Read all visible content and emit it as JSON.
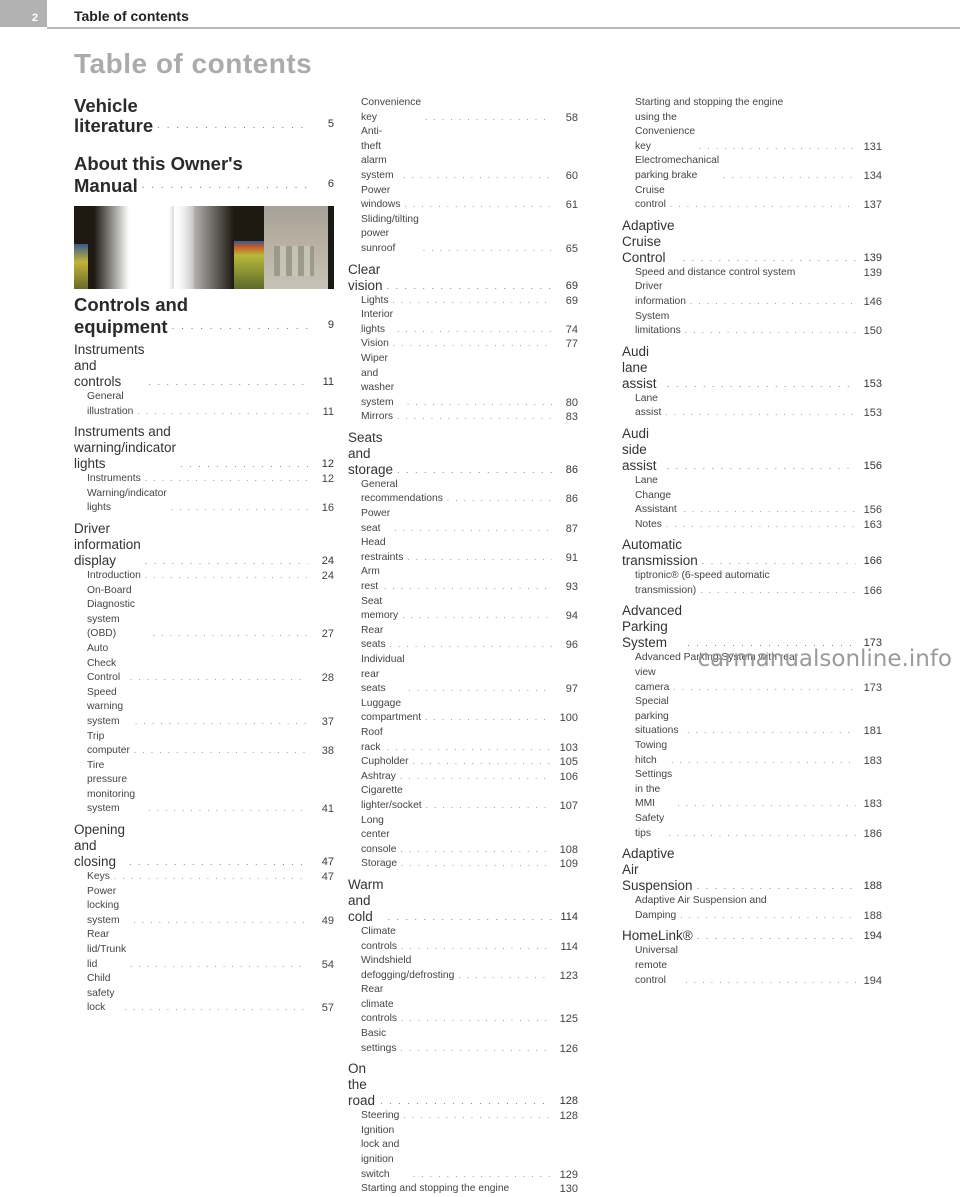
{
  "header": {
    "page_number": "2",
    "running_head": "Table of contents"
  },
  "title": "Table of contents",
  "columns": [
    {
      "blocks": [
        {
          "type": "big",
          "label": "Vehicle literature",
          "page": "5"
        },
        {
          "type": "big",
          "label_line1": "About this Owner's",
          "label": "Manual",
          "page": "6"
        },
        {
          "type": "image",
          "icon": "cockpit-photo"
        },
        {
          "type": "big",
          "label_line1": "Controls and",
          "label": "equipment",
          "page": "9"
        },
        {
          "type": "sec",
          "label": "Instruments and controls",
          "page": "11"
        },
        {
          "type": "sub",
          "label": "General illustration",
          "page": "11"
        },
        {
          "type": "sec",
          "label_line1": "Instruments and",
          "label": "warning/indicator lights",
          "page": "12"
        },
        {
          "type": "sub",
          "label": "Instruments",
          "page": "12"
        },
        {
          "type": "sub",
          "label": "Warning/indicator lights",
          "page": "16"
        },
        {
          "type": "sec",
          "label": "Driver information display",
          "page": "24"
        },
        {
          "type": "sub",
          "label": "Introduction",
          "page": "24"
        },
        {
          "type": "sub",
          "label": "On-Board Diagnostic system (OBD)",
          "page": "27"
        },
        {
          "type": "sub",
          "label": "Auto Check Control",
          "page": "28"
        },
        {
          "type": "sub",
          "label": "Speed warning system",
          "page": "37"
        },
        {
          "type": "sub",
          "label": "Trip computer",
          "page": "38"
        },
        {
          "type": "sub",
          "label": "Tire pressure monitoring system",
          "page": "41"
        },
        {
          "type": "sec",
          "label": "Opening and closing",
          "page": "47"
        },
        {
          "type": "sub",
          "label": "Keys",
          "page": "47"
        },
        {
          "type": "sub",
          "label": "Power locking system",
          "page": "49"
        },
        {
          "type": "sub",
          "label": "Rear lid/Trunk lid",
          "page": "54"
        },
        {
          "type": "sub",
          "label": "Child safety lock",
          "page": "57"
        }
      ]
    },
    {
      "blocks": [
        {
          "type": "sub",
          "label": "Convenience key",
          "page": "58"
        },
        {
          "type": "sub",
          "label": "Anti-theft alarm system",
          "page": "60"
        },
        {
          "type": "sub",
          "label": "Power windows",
          "page": "61"
        },
        {
          "type": "sub",
          "label": "Sliding/tilting power sunroof",
          "page": "65"
        },
        {
          "type": "sec",
          "label": "Clear vision",
          "page": "69"
        },
        {
          "type": "sub",
          "label": "Lights",
          "page": "69"
        },
        {
          "type": "sub",
          "label": "Interior lights",
          "page": "74"
        },
        {
          "type": "sub",
          "label": "Vision",
          "page": "77"
        },
        {
          "type": "sub",
          "label": "Wiper and washer system",
          "page": "80"
        },
        {
          "type": "sub",
          "label": "Mirrors",
          "page": "83"
        },
        {
          "type": "sec",
          "label": "Seats and storage",
          "page": "86"
        },
        {
          "type": "sub",
          "label": "General recommendations",
          "page": "86"
        },
        {
          "type": "sub",
          "label": "Power seat",
          "page": "87"
        },
        {
          "type": "sub",
          "label": "Head restraints",
          "page": "91"
        },
        {
          "type": "sub",
          "label": "Arm rest",
          "page": "93"
        },
        {
          "type": "sub",
          "label": "Seat memory",
          "page": "94"
        },
        {
          "type": "sub",
          "label": "Rear seats",
          "page": "96"
        },
        {
          "type": "sub",
          "label": "Individual rear seats",
          "page": "97"
        },
        {
          "type": "sub",
          "label": "Luggage compartment",
          "page": "100"
        },
        {
          "type": "sub",
          "label": "Roof rack",
          "page": "103"
        },
        {
          "type": "sub",
          "label": "Cupholder",
          "page": "105"
        },
        {
          "type": "sub",
          "label": "Ashtray",
          "page": "106"
        },
        {
          "type": "sub",
          "label": "Cigarette lighter/socket",
          "page": "107"
        },
        {
          "type": "sub",
          "label": "Long center console",
          "page": "108"
        },
        {
          "type": "sub",
          "label": "Storage",
          "page": "109"
        },
        {
          "type": "sec",
          "label": "Warm and cold",
          "page": "114"
        },
        {
          "type": "sub",
          "label": "Climate controls",
          "page": "114"
        },
        {
          "type": "sub",
          "label": "Windshield defogging/defrosting",
          "page": "123"
        },
        {
          "type": "sub",
          "label": "Rear climate controls",
          "page": "125"
        },
        {
          "type": "sub",
          "label": "Basic settings",
          "page": "126"
        },
        {
          "type": "sec",
          "label": "On the road",
          "page": "128"
        },
        {
          "type": "sub",
          "label": "Steering",
          "page": "128"
        },
        {
          "type": "sub",
          "label": "Ignition lock and ignition switch",
          "page": "129"
        },
        {
          "type": "sub",
          "label": "Starting and stopping the engine",
          "page": "130",
          "nodots": true
        }
      ]
    },
    {
      "blocks": [
        {
          "type": "sub",
          "label_line1": "Starting and stopping the engine",
          "label": "using the Convenience key",
          "page": "131"
        },
        {
          "type": "sub",
          "label": "Electromechanical parking brake",
          "page": "134"
        },
        {
          "type": "sub",
          "label": "Cruise control",
          "page": "137"
        },
        {
          "type": "sec",
          "label": "Adaptive Cruise Control",
          "page": "139"
        },
        {
          "type": "sub",
          "label": "Speed and distance control system",
          "page": "139",
          "nodots": true
        },
        {
          "type": "sub",
          "label": "Driver information",
          "page": "146"
        },
        {
          "type": "sub",
          "label": "System limitations",
          "page": "150"
        },
        {
          "type": "sec",
          "label": "Audi lane assist",
          "page": "153"
        },
        {
          "type": "sub",
          "label": "Lane assist",
          "page": "153"
        },
        {
          "type": "sec",
          "label": "Audi side assist",
          "page": "156"
        },
        {
          "type": "sub",
          "label": "Lane Change Assistant",
          "page": "156"
        },
        {
          "type": "sub",
          "label": "Notes",
          "page": "163"
        },
        {
          "type": "sec",
          "label": "Automatic transmission",
          "page": "166"
        },
        {
          "type": "sub",
          "label_line1": "tiptronic® (6-speed automatic",
          "label": "transmission)",
          "page": "166"
        },
        {
          "type": "sec",
          "label": "Advanced Parking System",
          "page": "173"
        },
        {
          "type": "sub",
          "label_line1": "Advanced Parking System with rear",
          "label": "view camera",
          "page": "173"
        },
        {
          "type": "sub",
          "label": "Special parking situations",
          "page": "181"
        },
        {
          "type": "sub",
          "label": "Towing hitch",
          "page": "183"
        },
        {
          "type": "sub",
          "label": "Settings in the MMI",
          "page": "183"
        },
        {
          "type": "sub",
          "label": "Safety tips",
          "page": "186"
        },
        {
          "type": "sec",
          "label": "Adaptive Air Suspension",
          "page": "188"
        },
        {
          "type": "sub",
          "label_line1": "Adaptive Air Suspension and",
          "label": "Damping",
          "page": "188"
        },
        {
          "type": "sec",
          "label": "HomeLink®",
          "page": "194"
        },
        {
          "type": "sub",
          "label": "Universal remote control",
          "page": "194"
        }
      ]
    }
  ],
  "watermark": "carmanualsonline.info"
}
